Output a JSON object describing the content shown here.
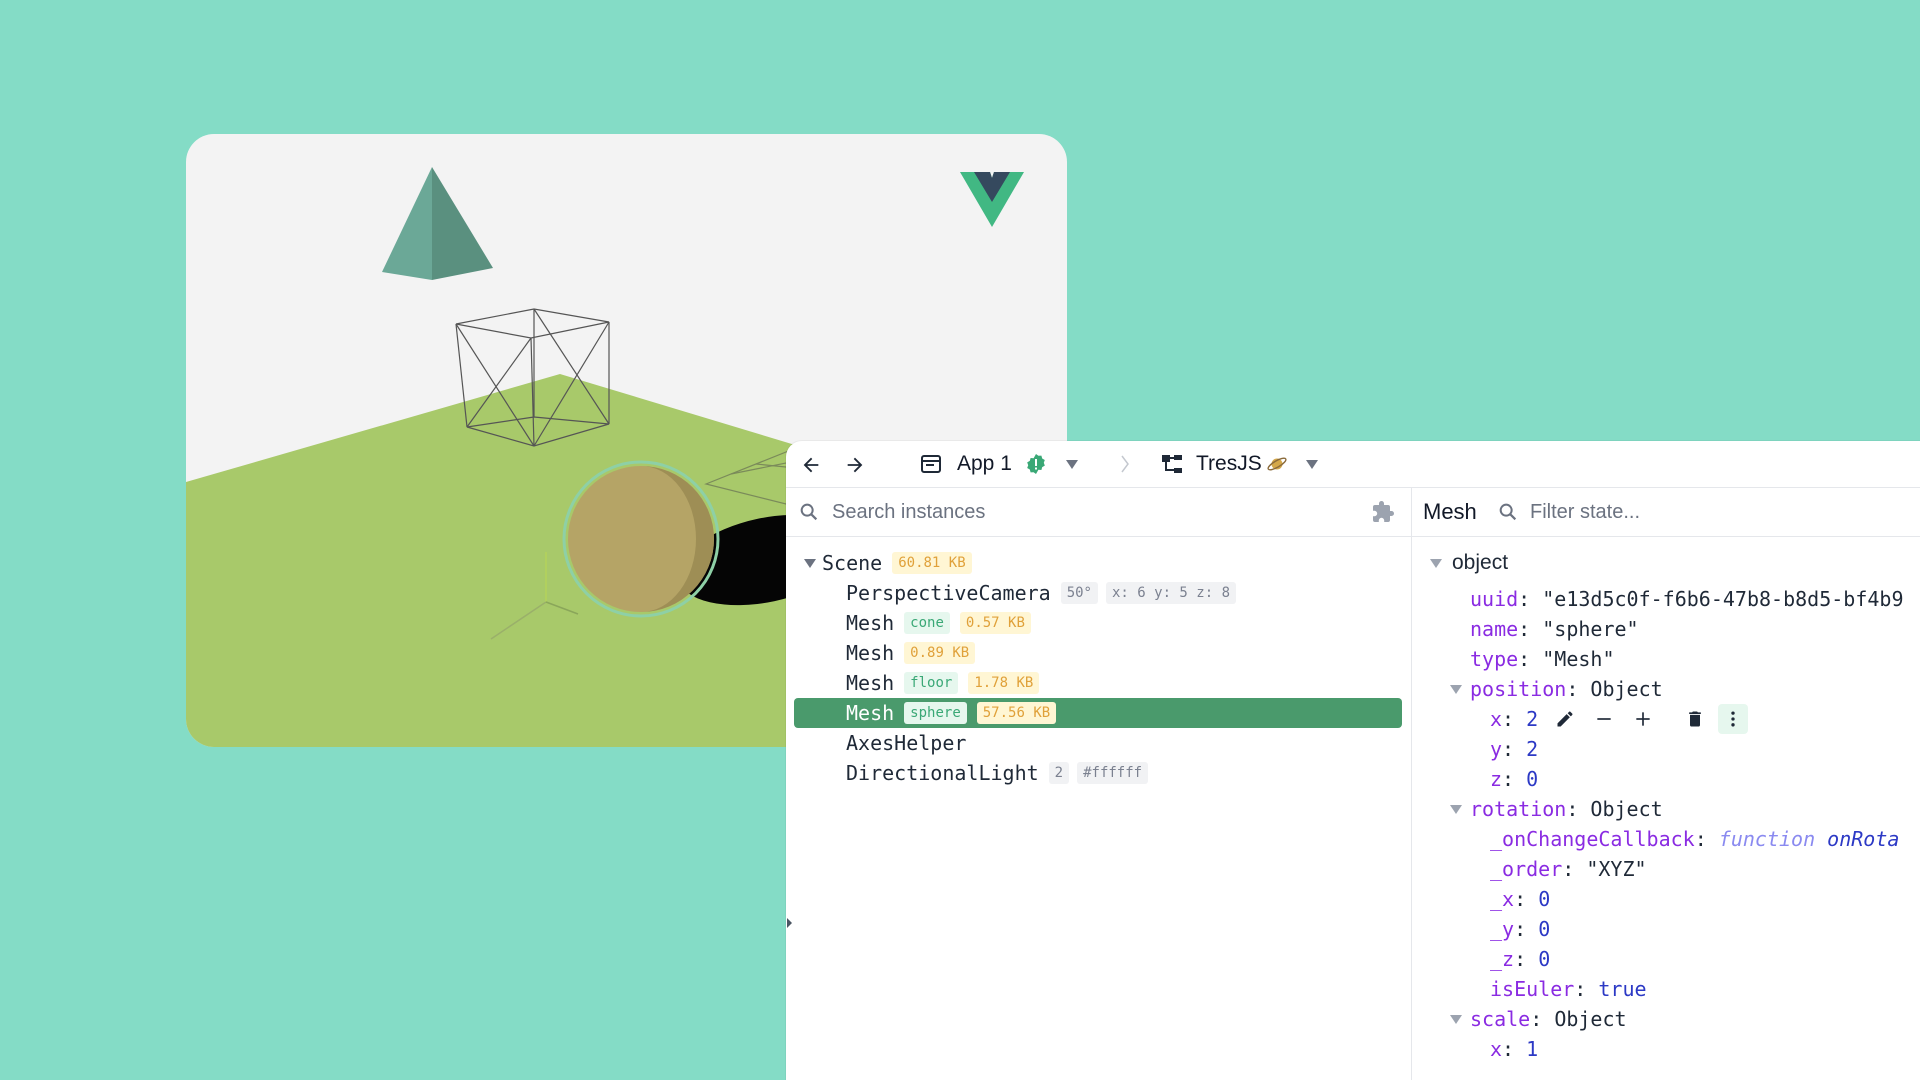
{
  "toolbar": {
    "app_label": "App 1",
    "plugin_label": "TresJS"
  },
  "inspector": {
    "search_placeholder": "Search instances",
    "tree": [
      {
        "label": "Scene",
        "badges": [
          {
            "text": "60.81 KB",
            "kind": "size"
          }
        ],
        "selected": false
      },
      {
        "label": "PerspectiveCamera",
        "badges": [
          {
            "text": "50°",
            "kind": "gray"
          },
          {
            "text": "x: 6 y: 5 z: 8",
            "kind": "gray"
          }
        ],
        "selected": false
      },
      {
        "label": "Mesh",
        "badges": [
          {
            "text": "cone",
            "kind": "name"
          },
          {
            "text": "0.57 KB",
            "kind": "size"
          }
        ],
        "selected": false
      },
      {
        "label": "Mesh",
        "badges": [
          {
            "text": "0.89 KB",
            "kind": "size"
          }
        ],
        "selected": false
      },
      {
        "label": "Mesh",
        "badges": [
          {
            "text": "floor",
            "kind": "name"
          },
          {
            "text": "1.78 KB",
            "kind": "size"
          }
        ],
        "selected": false
      },
      {
        "label": "Mesh",
        "badges": [
          {
            "text": "sphere",
            "kind": "name"
          },
          {
            "text": "57.56 KB",
            "kind": "size"
          }
        ],
        "selected": true
      },
      {
        "label": "AxesHelper",
        "badges": [],
        "selected": false
      },
      {
        "label": "DirectionalLight",
        "badges": [
          {
            "text": "2",
            "kind": "gray"
          },
          {
            "text": "#ffffff",
            "kind": "gray"
          }
        ],
        "selected": false
      }
    ]
  },
  "state": {
    "title": "Mesh",
    "filter_placeholder": "Filter state...",
    "section": "object",
    "uuid_key": "uuid",
    "uuid_val": "\"e13d5c0f-f6b6-47b8-b8d5-bf4b9",
    "name_key": "name",
    "name_val": "\"sphere\"",
    "type_key": "type",
    "type_val": "\"Mesh\"",
    "position_key": "position",
    "object_word": "Object",
    "px_key": "x",
    "px_val": "2",
    "py_key": "y",
    "py_val": "2",
    "pz_key": "z",
    "pz_val": "0",
    "rotation_key": "rotation",
    "onchange_key": "_onChangeCallback",
    "function_word": "function",
    "onchange_name": "onRota",
    "order_key": "_order",
    "order_val": "\"XYZ\"",
    "rx_key": "_x",
    "rx_val": "0",
    "ry_key": "_y",
    "ry_val": "0",
    "rz_key": "_z",
    "rz_val": "0",
    "iseuler_key": "isEuler",
    "iseuler_val": "true",
    "scale_key": "scale",
    "sx_key": "x",
    "sx_val": "1"
  },
  "colors": {
    "background": "#84dcc6",
    "selected_row": "#4a9a6c",
    "floor": "#a8c96a",
    "sphere": "#b5a466",
    "cone": "#6ba897",
    "vue_green": "#41b883",
    "vue_dark": "#35495e"
  },
  "icons": [
    "arrow-left-icon",
    "arrow-right-icon",
    "app-window-icon",
    "alert-badge-icon",
    "chevron-down-icon",
    "breadcrumb-chevron-icon",
    "tree-structure-icon",
    "saturn-icon",
    "search-icon",
    "puzzle-icon",
    "pencil-icon",
    "minus-icon",
    "plus-icon",
    "trash-icon",
    "more-vertical-icon",
    "expand-handle-icon"
  ]
}
